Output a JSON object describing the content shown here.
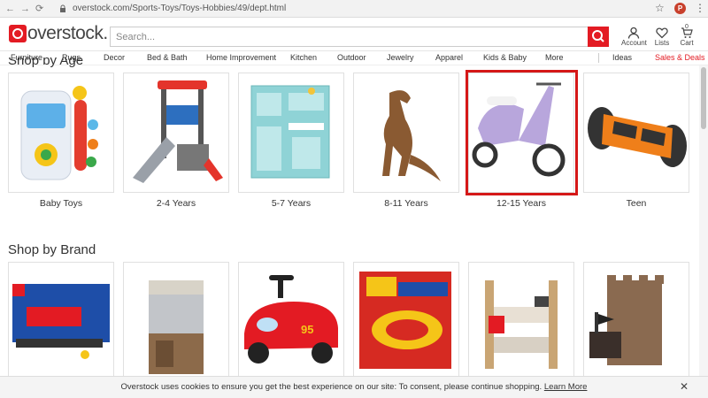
{
  "browser": {
    "url": "overstock.com/Sports-Toys/Toys-Hobbies/49/dept.html",
    "profile_initial": "P"
  },
  "header": {
    "logo_text": "overstock.",
    "search_placeholder": "Search...",
    "account_label": "Account",
    "lists_label": "Lists",
    "cart_label": "Cart",
    "cart_count": "0"
  },
  "nav": {
    "items": [
      "Furniture",
      "Rugs",
      "Decor",
      "Bed & Bath",
      "Home Improvement",
      "Kitchen",
      "Outdoor",
      "Jewelry",
      "Apparel",
      "Kids & Baby",
      "More",
      "Ideas",
      "Sales & Deals"
    ]
  },
  "age_section": {
    "title_partial": "Shop by Age",
    "items": [
      {
        "label": "Baby Toys"
      },
      {
        "label": "2-4 Years"
      },
      {
        "label": "5-7 Years"
      },
      {
        "label": "8-11 Years"
      },
      {
        "label": "12-15 Years"
      },
      {
        "label": "Teen"
      }
    ]
  },
  "brand_section": {
    "title": "Shop by Brand"
  },
  "cookie": {
    "text": "Overstock uses cookies to ensure you get the best experience on our site: To consent, please continue shopping.",
    "link": "Learn More"
  },
  "colors": {
    "brand_red": "#e31b23",
    "highlight_red": "#d51818",
    "sales_red": "#e31b23"
  }
}
